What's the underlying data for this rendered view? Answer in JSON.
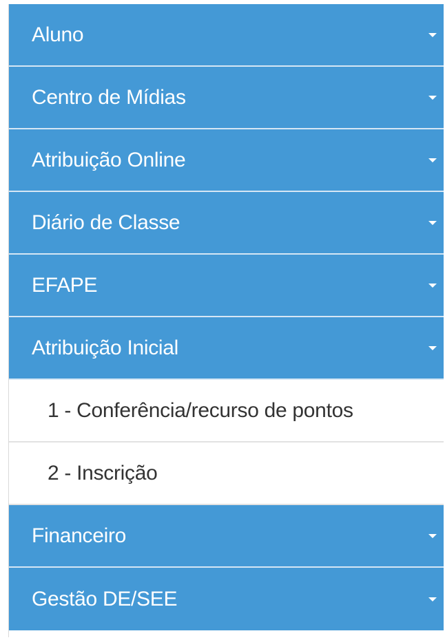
{
  "colors": {
    "menu_bg": "#4499d6",
    "menu_text": "#ffffff",
    "submenu_bg": "#ffffff",
    "submenu_text": "#333333"
  },
  "menu": {
    "items": [
      {
        "label": "Aluno",
        "icon": "caret-down-icon"
      },
      {
        "label": "Centro de Mídias",
        "icon": "caret-down-icon"
      },
      {
        "label": "Atribuição Online",
        "icon": "caret-down-icon"
      },
      {
        "label": "Diário de Classe",
        "icon": "caret-down-icon"
      },
      {
        "label": "EFAPE",
        "icon": "caret-down-icon"
      },
      {
        "label": "Atribuição Inicial",
        "icon": "caret-down-icon",
        "expanded": true,
        "children": [
          {
            "label": "1 - Conferência/recurso de pontos"
          },
          {
            "label": "2 - Inscrição"
          }
        ]
      },
      {
        "label": "Financeiro",
        "icon": "caret-down-icon"
      },
      {
        "label": "Gestão DE/SEE",
        "icon": "caret-down-icon"
      }
    ]
  }
}
